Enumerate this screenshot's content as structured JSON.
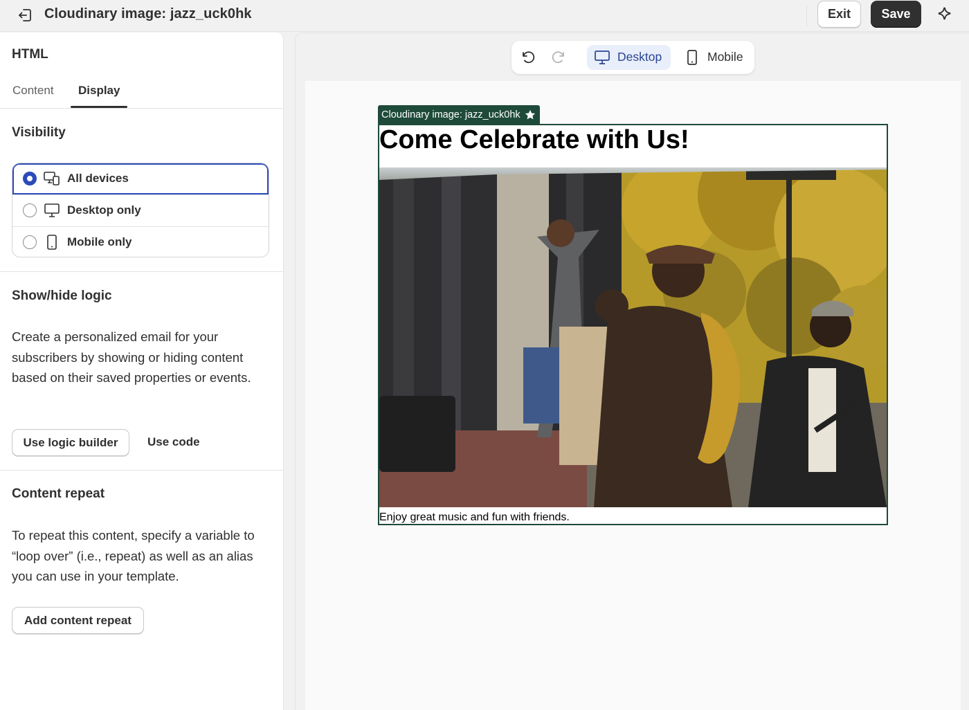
{
  "header": {
    "title": "Cloudinary image: jazz_uck0hk",
    "exit_label": "Exit",
    "save_label": "Save",
    "icons": [
      "back-arrow-icon",
      "sparkle-icon"
    ]
  },
  "left_panel": {
    "heading": "HTML",
    "tabs": [
      {
        "label": "Content",
        "active": false
      },
      {
        "label": "Display",
        "active": true
      }
    ],
    "visibility": {
      "title": "Visibility",
      "options": [
        {
          "label": "All devices",
          "icon": "devices-icon",
          "selected": true
        },
        {
          "label": "Desktop only",
          "icon": "desktop-icon",
          "selected": false
        },
        {
          "label": "Mobile only",
          "icon": "mobile-icon",
          "selected": false
        }
      ]
    },
    "show_hide": {
      "title": "Show/hide logic",
      "description": "Create a personalized email for your subscribers by showing or hiding content based on their saved properties or events.",
      "builder_label": "Use logic builder",
      "code_label": "Use code"
    },
    "content_repeat": {
      "title": "Content repeat",
      "description": "To repeat this content, specify a variable to “loop over” (i.e., repeat) as well as an alias you can use in your template.",
      "button_label": "Add content repeat"
    }
  },
  "preview": {
    "toolbar": {
      "desktop_label": "Desktop",
      "mobile_label": "Mobile",
      "active_view": "Desktop",
      "icons": [
        "undo-icon",
        "redo-icon",
        "desktop-icon",
        "mobile-icon"
      ]
    },
    "block": {
      "tag_label": "Cloudinary image: jazz_uck0hk",
      "heading": "Come Celebrate with Us!",
      "caption": "Enjoy great music and fun with friends.",
      "image_subject": "jazz street performance with saxophonist",
      "accent_color": "#1e4a3a"
    }
  },
  "colors": {
    "primary_dark": "#303030",
    "selected_blue": "#2c4bba",
    "desktop_toggle_bg": "#e9eefb",
    "block_green": "#1e4a3a"
  }
}
